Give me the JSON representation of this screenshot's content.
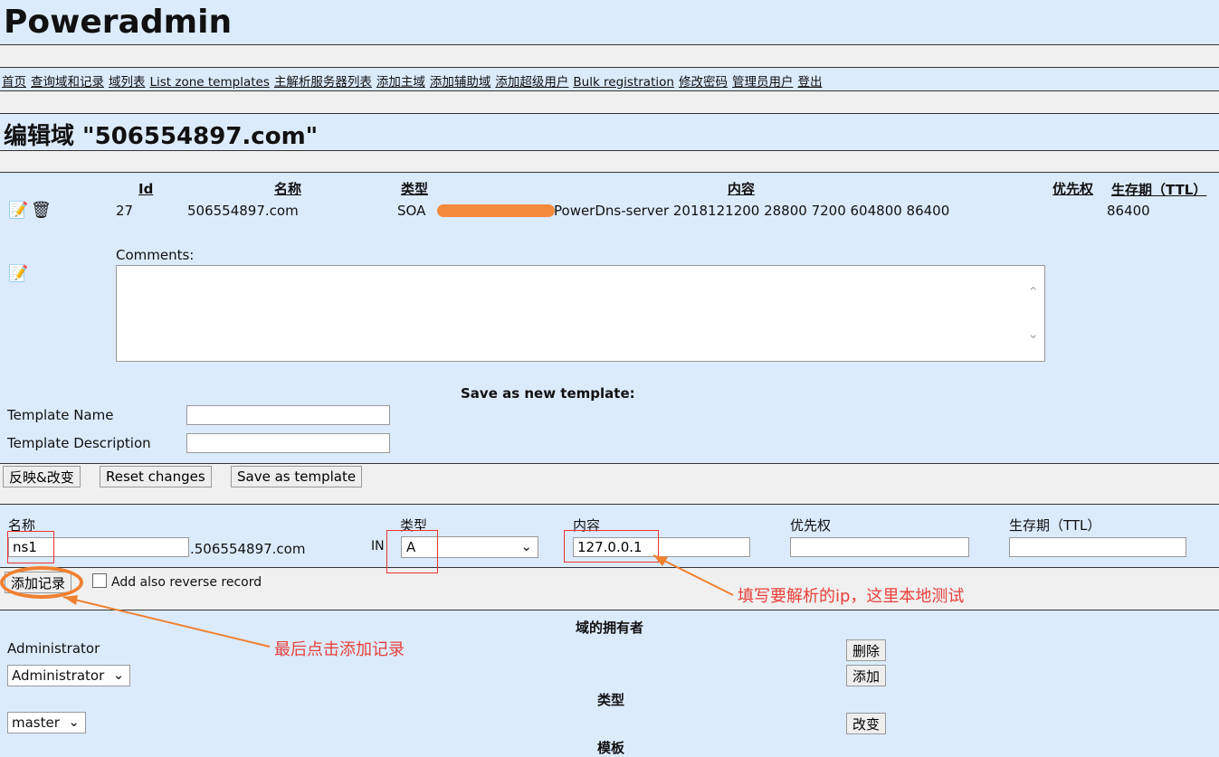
{
  "app_title": "Poweradmin",
  "nav": [
    "首页",
    "查询域和记录",
    "域列表",
    "List zone templates",
    "主解析服务器列表",
    "添加主域",
    "添加辅助域",
    "添加超级用户",
    "Bulk registration",
    "修改密码",
    "管理员用户",
    "登出"
  ],
  "page_title": "编辑域 \"506554897.com\"",
  "table": {
    "headers": {
      "id": "Id",
      "name": "名称",
      "type": "类型",
      "content": "内容",
      "priority": "优先权",
      "ttl": "生存期（TTL）"
    },
    "row": {
      "id": "27",
      "name": "506554897.com",
      "type": "SOA",
      "content": "PowerDns-server 2018121200 28800 7200 604800 86400",
      "ttl": "86400"
    }
  },
  "comments_label": "Comments:",
  "template": {
    "heading": "Save as new template:",
    "name_label": "Template Name",
    "desc_label": "Template Description"
  },
  "buttons": {
    "apply": "反映&改变",
    "reset": "Reset changes",
    "save_template": "Save as template",
    "add_record": "添加记录",
    "delete": "删除",
    "add": "添加",
    "change": "改变"
  },
  "add_record": {
    "name_label": "名称",
    "name_value": "ns1",
    "domain_suffix": ".506554897.com",
    "in": "IN",
    "type_label": "类型",
    "type_value": "A",
    "content_label": "内容",
    "content_value": "127.0.0.1",
    "priority_label": "优先权",
    "ttl_label": "生存期（TTL）",
    "reverse_label": "Add also reverse record"
  },
  "owner": {
    "heading": "域的拥有者",
    "owner": "Administrator",
    "select": "Administrator",
    "type_heading": "类型",
    "type_select": "master",
    "template_heading": "模板"
  },
  "annotations": {
    "ip_note": "填写要解析的ip，这里本地测试",
    "click_note": "最后点击添加记录",
    "accent": "#f08030"
  }
}
